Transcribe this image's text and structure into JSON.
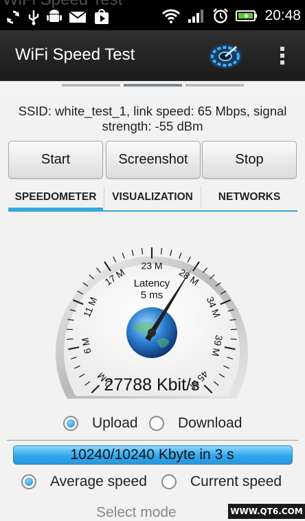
{
  "status_bar": {
    "ghost_title": "WiFi Speed Test",
    "time": "20:48",
    "icons_left": [
      "sync-icon",
      "usb-icon",
      "android-debug-icon",
      "gmail-icon",
      "play-store-icon"
    ],
    "icons_right": [
      "wifi-icon",
      "signal-icon",
      "alarm-icon",
      "battery-icon"
    ]
  },
  "action_bar": {
    "title": "WiFi Speed Test"
  },
  "pager": {
    "pages": 3,
    "active_index": 1
  },
  "ssid_info": {
    "line1": "SSID: white_test_1, link speed: 65 Mbps, signal",
    "line2": "strength: -55 dBm"
  },
  "buttons": {
    "start": "Start",
    "screenshot": "Screenshot",
    "stop": "Stop"
  },
  "tabs": [
    {
      "label": "SPEEDOMETER",
      "active": true
    },
    {
      "label": "VISUALIZATION",
      "active": false
    },
    {
      "label": "NETWORKS",
      "active": false
    }
  ],
  "gauge": {
    "scale_labels": [
      "0 M",
      "6 M",
      "11 M",
      "17 M",
      "23 M",
      "28 M",
      "34 M",
      "39 M",
      "45 M"
    ],
    "scale_max_mbps": 45,
    "needle_value_kbits": 27788,
    "latency_label": "Latency",
    "latency_value": "5 ms",
    "readout": "27788 Kbit/s"
  },
  "direction": {
    "upload": "Upload",
    "download": "Download",
    "selected": "upload"
  },
  "progress": {
    "text": "10240/10240 Kbyte in 3 s",
    "fraction": 1.0
  },
  "speed_mode": {
    "average": "Average speed",
    "current": "Current speed",
    "selected": "average"
  },
  "select_mode": "Select mode",
  "watermark": "WWW.QT6.COM",
  "colors": {
    "accent": "#35a9e0",
    "actionbar": "#222222",
    "progress": "#2fa6ec"
  }
}
